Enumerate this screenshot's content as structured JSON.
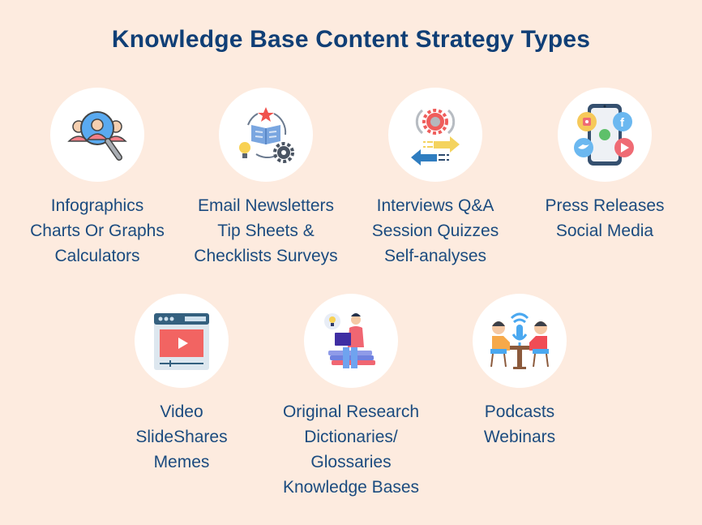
{
  "title": "Knowledge Base Content Strategy Types",
  "items": [
    {
      "icon": "magnifier-people-icon",
      "lines": [
        "Infographics",
        "Charts Or Graphs",
        "Calculators"
      ]
    },
    {
      "icon": "book-cycle-icon",
      "lines": [
        "Email Newsletters",
        "Tip Sheets &",
        "Checklists Surveys"
      ]
    },
    {
      "icon": "gear-arrows-exchange-icon",
      "lines": [
        "Interviews Q&A",
        "Session Quizzes",
        "Self-analyses"
      ]
    },
    {
      "icon": "phone-social-media-icon",
      "lines": [
        "Press Releases",
        "Social Media"
      ]
    },
    {
      "icon": "video-player-icon",
      "lines": [
        "Video",
        "SlideShares",
        "Memes"
      ]
    },
    {
      "icon": "person-laptop-books-icon",
      "lines": [
        "Original Research",
        "Dictionaries/",
        "Glossaries",
        "Knowledge Bases"
      ]
    },
    {
      "icon": "podcast-microphone-icon",
      "lines": [
        "Podcasts",
        "Webinars"
      ]
    }
  ]
}
